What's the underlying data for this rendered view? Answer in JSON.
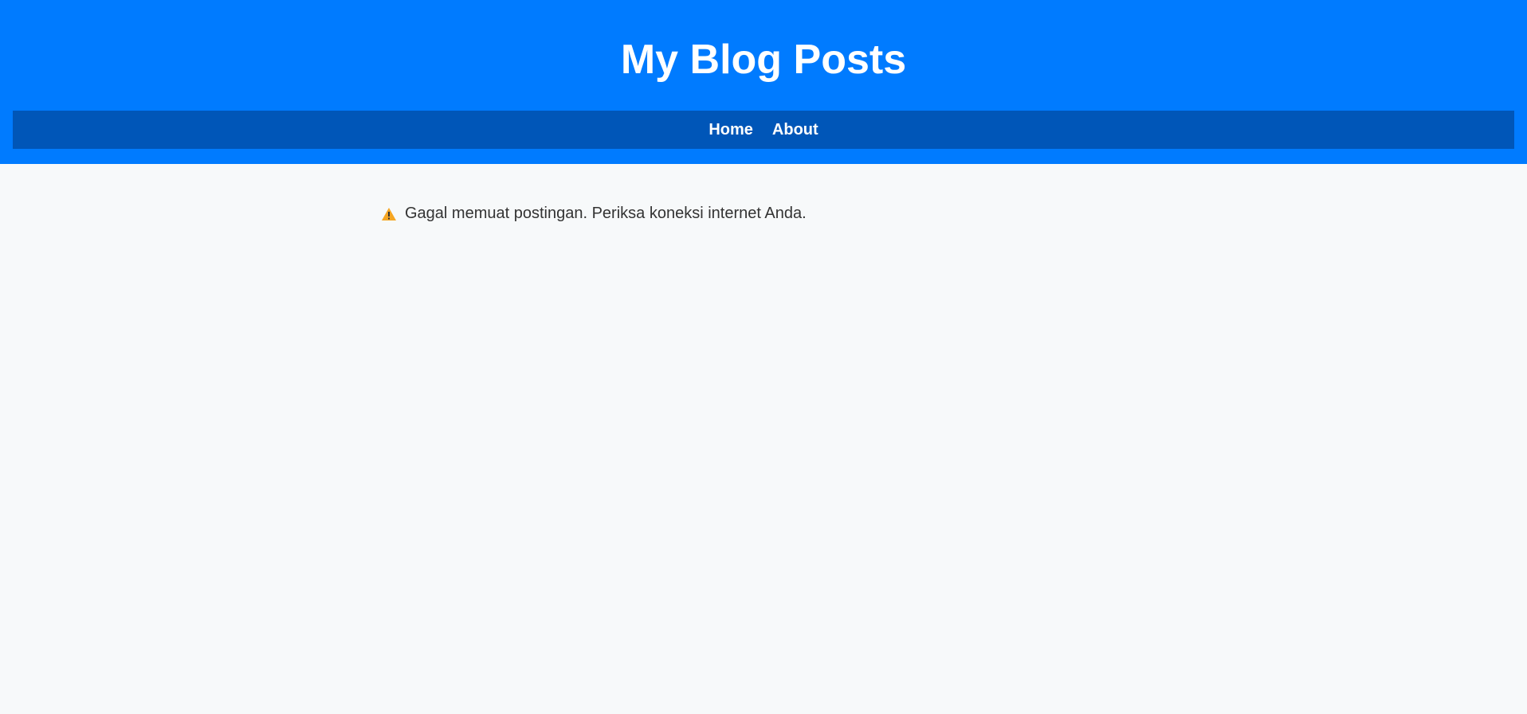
{
  "header": {
    "title": "My Blog Posts"
  },
  "nav": {
    "items": [
      {
        "label": "Home"
      },
      {
        "label": "About"
      }
    ]
  },
  "main": {
    "error_icon": "warning-icon",
    "error_text": "Gagal memuat postingan. Periksa koneksi internet Anda."
  },
  "colors": {
    "header_bg": "#007bff",
    "nav_bg": "#0056b8",
    "page_bg": "#f7f9fa",
    "warning": "#f5a623"
  }
}
